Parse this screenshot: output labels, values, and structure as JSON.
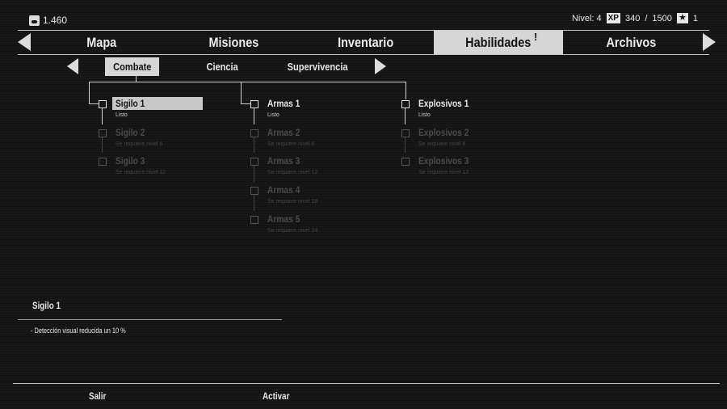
{
  "hud": {
    "money": "1.460",
    "level": "Nivel: 4",
    "xp_label": "XP",
    "xp_current": "340",
    "xp_sep": "/",
    "xp_max": "1500",
    "stars": "1"
  },
  "nav": {
    "tabs": [
      {
        "label": "Mapa"
      },
      {
        "label": "Misiones"
      },
      {
        "label": "Inventario"
      },
      {
        "label": "Habilidades"
      },
      {
        "label": "Archivos"
      }
    ],
    "active_tab": "Habilidades",
    "alert_mark": "!"
  },
  "subnav": {
    "tabs": [
      {
        "label": "Combate"
      },
      {
        "label": "Ciencia"
      },
      {
        "label": "Supervivencia"
      }
    ],
    "active": "Combate"
  },
  "tree": {
    "columns": [
      {
        "skills": [
          {
            "name": "Sigilo 1",
            "status": "Listo"
          },
          {
            "name": "Sigilo 2",
            "status": "Se requiere nivel 6"
          },
          {
            "name": "Sigilo 3",
            "status": "Se requiere nivel 12"
          }
        ]
      },
      {
        "skills": [
          {
            "name": "Armas 1",
            "status": "Listo"
          },
          {
            "name": "Armas 2",
            "status": "Se requiere nivel 6"
          },
          {
            "name": "Armas 3",
            "status": "Se requiere nivel 12"
          },
          {
            "name": "Armas 4",
            "status": "Se requiere nivel 18"
          },
          {
            "name": "Armas 5",
            "status": "Se requiere nivel 24"
          }
        ]
      },
      {
        "skills": [
          {
            "name": "Explosivos 1",
            "status": "Listo"
          },
          {
            "name": "Explosivos 2",
            "status": "Se requiere nivel 6"
          },
          {
            "name": "Explosivos 3",
            "status": "Se requiere nivel 12"
          }
        ]
      }
    ]
  },
  "details": {
    "title": "Sigilo 1",
    "description": "- Detección visual reducida un 10 %"
  },
  "footer": {
    "exit": "Salir",
    "activate": "Activar"
  }
}
